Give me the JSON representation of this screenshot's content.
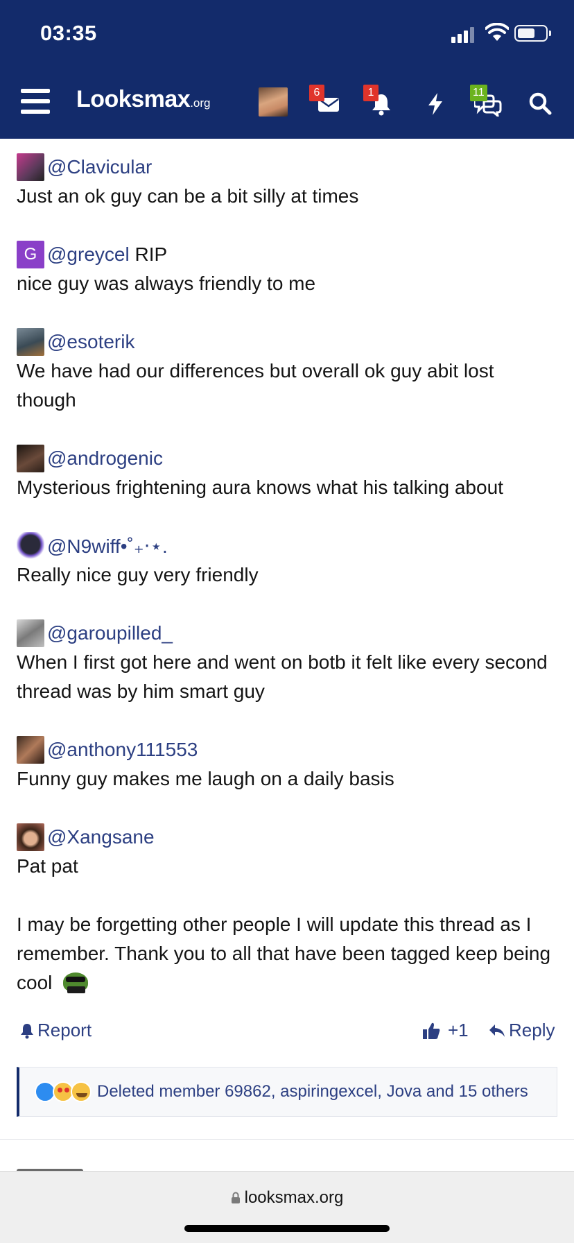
{
  "status_bar": {
    "time": "03:35"
  },
  "header": {
    "logo_main": "Looksmax",
    "logo_suffix": ".org",
    "badges": {
      "inbox": "6",
      "alerts": "1",
      "conversations": "11"
    }
  },
  "mentions": [
    {
      "handle": "@Clavicular",
      "suffix": "",
      "description": "Just an ok guy can be a bit silly at times",
      "avatar_color": "#b05a8a"
    },
    {
      "handle": "@greycel",
      "suffix": " RIP",
      "description": "nice guy was always friendly to me",
      "avatar_letter": "G",
      "avatar_color": "#8a3fc8"
    },
    {
      "handle": "@esoterik",
      "suffix": "",
      "description": "We have had our differences but overall ok guy abit lost though",
      "avatar_color": "#5a6b7a"
    },
    {
      "handle": "@androgenic",
      "suffix": "",
      "description": "Mysterious frightening aura knows what his talking about",
      "avatar_color": "#3a2a22"
    },
    {
      "handle": "@N9wiff•˚₊‧⋆.",
      "suffix": "",
      "description": "Really nice guy very friendly",
      "avatar_color": "#2f2f3f"
    },
    {
      "handle": "@garoupilled_",
      "suffix": "",
      "description": "When I first got here and went on botb it felt like every second thread was by him smart guy",
      "avatar_color": "#9a9a9a"
    },
    {
      "handle": "@anthony111553",
      "suffix": "",
      "description": "Funny guy makes me laugh on a daily basis",
      "avatar_color": "#5a4030"
    },
    {
      "handle": "@Xangsane",
      "suffix": "",
      "description": "Pat pat",
      "avatar_color": "#8a4a3a"
    }
  ],
  "closing_text": "I may be forgetting other people I will update this thread as I remember. Thank you to all that have been tagged keep being cool",
  "actions": {
    "report": "Report",
    "like_count": "+1",
    "reply": "Reply"
  },
  "reactions_summary": "Deleted member 69862, aspiringexcel, Jova and 15 others",
  "browser": {
    "url": "looksmax.org"
  },
  "colors": {
    "header_bg": "#132b6b",
    "link": "#2c3f82",
    "badge_red": "#e0342b",
    "badge_green": "#6bb31e"
  }
}
